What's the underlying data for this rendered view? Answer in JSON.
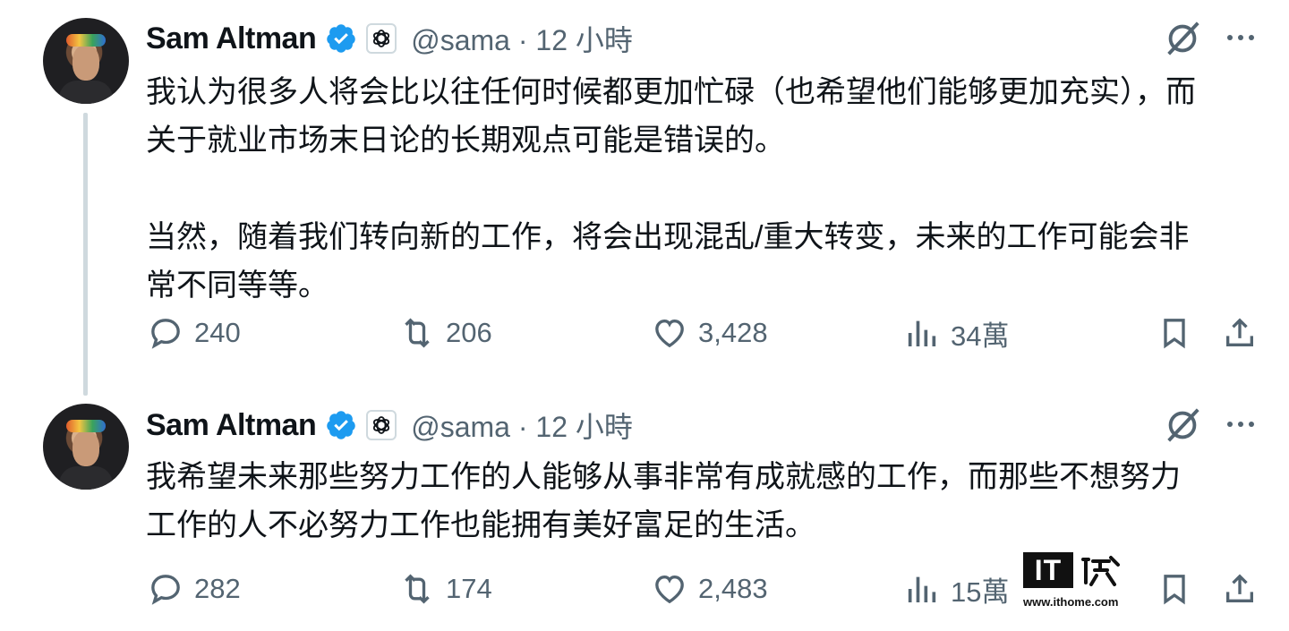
{
  "tweets": [
    {
      "author": "Sam Altman",
      "meta": "@sama · 12 小時",
      "text": "我认为很多人将会比以往任何时候都更加忙碌（也希望他们能够更加充实），而\n关于就业市场末日论的长期观点可能是错误的。\n\n当然，随着我们转向新的工作，将会出现混乱/重大转变，未来的工作可能会非\n常不同等等。",
      "replies": "240",
      "reposts": "206",
      "likes": "3,428",
      "views": "34萬"
    },
    {
      "author": "Sam Altman",
      "meta": "@sama · 12 小時",
      "text": "我希望未来那些努力工作的人能够从事非常有成就感的工作，而那些不想努力\n工作的人不必努力工作也能拥有美好富足的生活。",
      "replies": "282",
      "reposts": "174",
      "likes": "2,483",
      "views": "15萬"
    }
  ],
  "watermark": {
    "logo": "IT之家",
    "url": "www.ithome.com"
  },
  "icons": {
    "verified": "verified-badge-icon",
    "affiliation": "openai-logo-icon",
    "grok": "grok-icon",
    "more": "more-icon",
    "reply": "reply-icon",
    "repost": "repost-icon",
    "like": "heart-icon",
    "views": "views-icon",
    "bookmark": "bookmark-icon",
    "share": "share-icon"
  },
  "colors": {
    "verified": "#1d9bf0",
    "secondary_text": "#536471",
    "primary_text": "#0f1419",
    "thread_line": "#cfd9de"
  }
}
